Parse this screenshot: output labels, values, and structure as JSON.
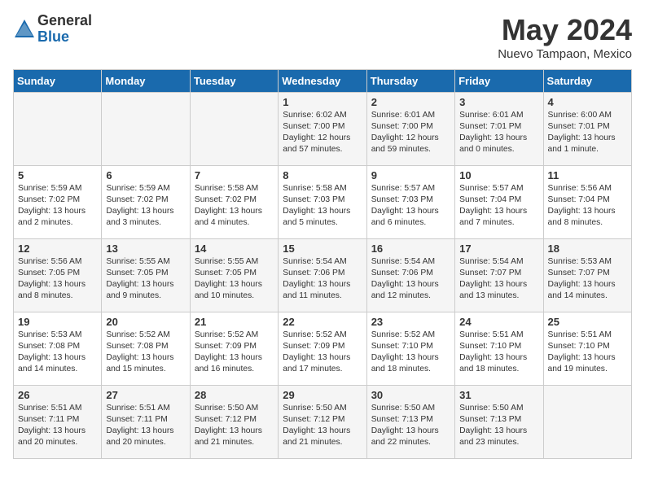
{
  "header": {
    "logo_general": "General",
    "logo_blue": "Blue",
    "month_title": "May 2024",
    "location": "Nuevo Tampaon, Mexico"
  },
  "days_of_week": [
    "Sunday",
    "Monday",
    "Tuesday",
    "Wednesday",
    "Thursday",
    "Friday",
    "Saturday"
  ],
  "weeks": [
    [
      {
        "day": "",
        "content": ""
      },
      {
        "day": "",
        "content": ""
      },
      {
        "day": "",
        "content": ""
      },
      {
        "day": "1",
        "content": "Sunrise: 6:02 AM\nSunset: 7:00 PM\nDaylight: 12 hours and 57 minutes."
      },
      {
        "day": "2",
        "content": "Sunrise: 6:01 AM\nSunset: 7:00 PM\nDaylight: 12 hours and 59 minutes."
      },
      {
        "day": "3",
        "content": "Sunrise: 6:01 AM\nSunset: 7:01 PM\nDaylight: 13 hours and 0 minutes."
      },
      {
        "day": "4",
        "content": "Sunrise: 6:00 AM\nSunset: 7:01 PM\nDaylight: 13 hours and 1 minute."
      }
    ],
    [
      {
        "day": "5",
        "content": "Sunrise: 5:59 AM\nSunset: 7:02 PM\nDaylight: 13 hours and 2 minutes."
      },
      {
        "day": "6",
        "content": "Sunrise: 5:59 AM\nSunset: 7:02 PM\nDaylight: 13 hours and 3 minutes."
      },
      {
        "day": "7",
        "content": "Sunrise: 5:58 AM\nSunset: 7:02 PM\nDaylight: 13 hours and 4 minutes."
      },
      {
        "day": "8",
        "content": "Sunrise: 5:58 AM\nSunset: 7:03 PM\nDaylight: 13 hours and 5 minutes."
      },
      {
        "day": "9",
        "content": "Sunrise: 5:57 AM\nSunset: 7:03 PM\nDaylight: 13 hours and 6 minutes."
      },
      {
        "day": "10",
        "content": "Sunrise: 5:57 AM\nSunset: 7:04 PM\nDaylight: 13 hours and 7 minutes."
      },
      {
        "day": "11",
        "content": "Sunrise: 5:56 AM\nSunset: 7:04 PM\nDaylight: 13 hours and 8 minutes."
      }
    ],
    [
      {
        "day": "12",
        "content": "Sunrise: 5:56 AM\nSunset: 7:05 PM\nDaylight: 13 hours and 8 minutes."
      },
      {
        "day": "13",
        "content": "Sunrise: 5:55 AM\nSunset: 7:05 PM\nDaylight: 13 hours and 9 minutes."
      },
      {
        "day": "14",
        "content": "Sunrise: 5:55 AM\nSunset: 7:05 PM\nDaylight: 13 hours and 10 minutes."
      },
      {
        "day": "15",
        "content": "Sunrise: 5:54 AM\nSunset: 7:06 PM\nDaylight: 13 hours and 11 minutes."
      },
      {
        "day": "16",
        "content": "Sunrise: 5:54 AM\nSunset: 7:06 PM\nDaylight: 13 hours and 12 minutes."
      },
      {
        "day": "17",
        "content": "Sunrise: 5:54 AM\nSunset: 7:07 PM\nDaylight: 13 hours and 13 minutes."
      },
      {
        "day": "18",
        "content": "Sunrise: 5:53 AM\nSunset: 7:07 PM\nDaylight: 13 hours and 14 minutes."
      }
    ],
    [
      {
        "day": "19",
        "content": "Sunrise: 5:53 AM\nSunset: 7:08 PM\nDaylight: 13 hours and 14 minutes."
      },
      {
        "day": "20",
        "content": "Sunrise: 5:52 AM\nSunset: 7:08 PM\nDaylight: 13 hours and 15 minutes."
      },
      {
        "day": "21",
        "content": "Sunrise: 5:52 AM\nSunset: 7:09 PM\nDaylight: 13 hours and 16 minutes."
      },
      {
        "day": "22",
        "content": "Sunrise: 5:52 AM\nSunset: 7:09 PM\nDaylight: 13 hours and 17 minutes."
      },
      {
        "day": "23",
        "content": "Sunrise: 5:52 AM\nSunset: 7:10 PM\nDaylight: 13 hours and 18 minutes."
      },
      {
        "day": "24",
        "content": "Sunrise: 5:51 AM\nSunset: 7:10 PM\nDaylight: 13 hours and 18 minutes."
      },
      {
        "day": "25",
        "content": "Sunrise: 5:51 AM\nSunset: 7:10 PM\nDaylight: 13 hours and 19 minutes."
      }
    ],
    [
      {
        "day": "26",
        "content": "Sunrise: 5:51 AM\nSunset: 7:11 PM\nDaylight: 13 hours and 20 minutes."
      },
      {
        "day": "27",
        "content": "Sunrise: 5:51 AM\nSunset: 7:11 PM\nDaylight: 13 hours and 20 minutes."
      },
      {
        "day": "28",
        "content": "Sunrise: 5:50 AM\nSunset: 7:12 PM\nDaylight: 13 hours and 21 minutes."
      },
      {
        "day": "29",
        "content": "Sunrise: 5:50 AM\nSunset: 7:12 PM\nDaylight: 13 hours and 21 minutes."
      },
      {
        "day": "30",
        "content": "Sunrise: 5:50 AM\nSunset: 7:13 PM\nDaylight: 13 hours and 22 minutes."
      },
      {
        "day": "31",
        "content": "Sunrise: 5:50 AM\nSunset: 7:13 PM\nDaylight: 13 hours and 23 minutes."
      },
      {
        "day": "",
        "content": ""
      }
    ]
  ]
}
